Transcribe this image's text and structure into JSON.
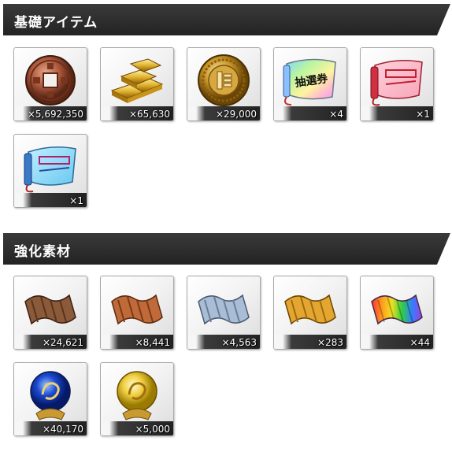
{
  "sections": [
    {
      "title": "基礎アイテム",
      "items": [
        {
          "name": "coin",
          "icon": "bronze-coin-icon",
          "quantity": "×5,692,350"
        },
        {
          "name": "gold-bars",
          "icon": "gold-bars-icon",
          "quantity": "×65,630"
        },
        {
          "name": "medal",
          "icon": "gold-medal-icon",
          "quantity": "×29,000"
        },
        {
          "name": "lottery-ticket",
          "icon": "lottery-ticket-icon",
          "label": "抽選券",
          "quantity": "×4"
        },
        {
          "name": "red-scroll",
          "icon": "red-scroll-icon",
          "quantity": "×1"
        },
        {
          "name": "blue-scroll",
          "icon": "blue-scroll-icon",
          "quantity": "×1"
        }
      ]
    },
    {
      "title": "強化素材",
      "items": [
        {
          "name": "brown-cloth",
          "icon": "brown-cloth-icon",
          "quantity": "×24,621"
        },
        {
          "name": "copper-cloth",
          "icon": "copper-cloth-icon",
          "quantity": "×8,441"
        },
        {
          "name": "silver-cloth",
          "icon": "silver-cloth-icon",
          "quantity": "×4,563"
        },
        {
          "name": "gold-cloth",
          "icon": "gold-cloth-icon",
          "quantity": "×283"
        },
        {
          "name": "rainbow-cloth",
          "icon": "rainbow-cloth-icon",
          "quantity": "×44"
        },
        {
          "name": "blue-orb",
          "icon": "blue-dragon-orb-icon",
          "quantity": "×40,170"
        },
        {
          "name": "gold-orb",
          "icon": "gold-dragon-orb-icon",
          "quantity": "×5,000"
        }
      ]
    }
  ],
  "colors": {
    "header_bg": "#2b2b2b",
    "qty_bar": "#2a2a2a",
    "tile_border": "#a8a8a8"
  }
}
